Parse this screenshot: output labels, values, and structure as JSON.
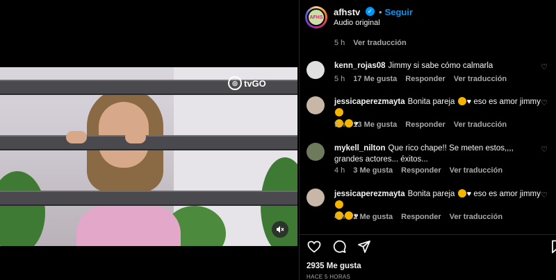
{
  "post": {
    "username": "afhstv",
    "follow_label": "Seguir",
    "audio": "Audio original",
    "likes": "2935 Me gusta",
    "posted": "HACE 5 HORAS"
  },
  "video": {
    "channel_logo": "tvGO"
  },
  "comments": [
    {
      "time": "5 h",
      "likes": "",
      "reply": "",
      "translate": "Ver traducción"
    },
    {
      "user": "kenn_rojas08",
      "text": "Jimmy si sabe cómo calmarla",
      "time": "5 h",
      "likes": "17 Me gusta",
      "reply": "Responder",
      "translate": "Ver traducción"
    },
    {
      "user": "jessicaperezmayta",
      "text": "Bonita pareja",
      "text2": "eso es amor jimmy",
      "time": "5 h",
      "likes": "13 Me gusta",
      "reply": "Responder",
      "translate": "Ver traducción"
    },
    {
      "user": "mykell_nilton",
      "text": "Que rico chape!! Se meten estos,,,, grandes actores... éxitos...",
      "time": "4 h",
      "likes": "3 Me gusta",
      "reply": "Responder",
      "translate": "Ver traducción"
    },
    {
      "user": "jessicaperezmayta",
      "text": "Bonita pareja",
      "text2": "eso es amor jimmy",
      "time": "4 h",
      "likes": "2 Me gusta",
      "reply": "Responder",
      "translate": "Ver traducción"
    }
  ],
  "icons": {
    "like": "heart-icon",
    "comment": "comment-icon",
    "share": "share-icon",
    "save": "bookmark-icon",
    "mute": "muted-speaker-icon",
    "verified": "verified-badge-icon"
  },
  "colors": {
    "accent": "#0095f6",
    "background": "#000000",
    "muted_text": "#a8a8a8"
  }
}
